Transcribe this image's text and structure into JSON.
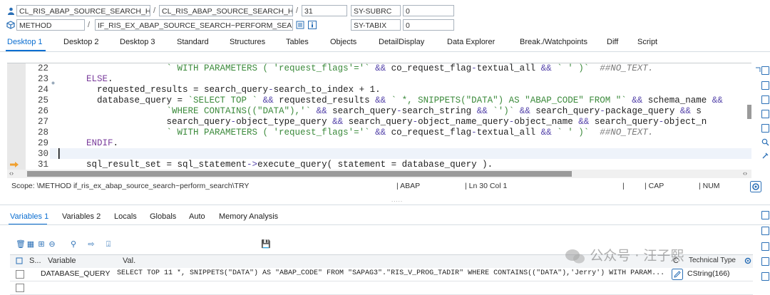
{
  "header": {
    "row1": {
      "class_field": "CL_RIS_ABAP_SOURCE_SEARCH_HAN...",
      "include_field": "CL_RIS_ABAP_SOURCE_SEARCH_HAN...",
      "line_field": "31",
      "var_name": "SY-SUBRC",
      "var_value": "0",
      "sep1": "/",
      "sep2": "/"
    },
    "row2": {
      "type_field": "METHOD",
      "method_field": "IF_RIS_EX_ABAP_SOURCE_SEARCH~PERFORM_SEA...",
      "var_name": "SY-TABIX",
      "var_value": "0",
      "sep1": "/"
    }
  },
  "tabs": [
    "Desktop 1",
    "Desktop 2",
    "Desktop 3",
    "Standard",
    "Structures",
    "Tables",
    "Objects",
    "DetailDisplay",
    "Data Explorer",
    "Break./Watchpoints",
    "Diff",
    "Script"
  ],
  "editor": {
    "line_numbers": [
      "22",
      "23",
      "24",
      "25",
      "26",
      "27",
      "28",
      "29",
      "30",
      "31"
    ],
    "lines": [
      [
        {
          "t": "                     ",
          "c": ""
        },
        {
          "t": "` WITH PARAMETERS ( 'request_flags'='` ",
          "c": "str"
        },
        {
          "t": "&&",
          "c": "op"
        },
        {
          "t": " co_request_flag",
          "c": ""
        },
        {
          "t": "-",
          "c": "op"
        },
        {
          "t": "textual_all ",
          "c": ""
        },
        {
          "t": "&&",
          "c": "op"
        },
        {
          "t": " ",
          "c": ""
        },
        {
          "t": "` ' )`",
          "c": "str"
        },
        {
          "t": "  ##NO_TEXT.",
          "c": "cm"
        }
      ],
      [
        {
          "t": "      ",
          "c": ""
        },
        {
          "t": "ELSE",
          "c": "kw"
        },
        {
          "t": ".",
          "c": ""
        }
      ],
      [
        {
          "t": "        requested_results = search_query",
          "c": ""
        },
        {
          "t": "-",
          "c": "op"
        },
        {
          "t": "search_to_index + 1.",
          "c": ""
        }
      ],
      [
        {
          "t": "        database_query = ",
          "c": ""
        },
        {
          "t": "`SELECT TOP `",
          "c": "str"
        },
        {
          "t": " ",
          "c": ""
        },
        {
          "t": "&&",
          "c": "op"
        },
        {
          "t": " requested_results ",
          "c": ""
        },
        {
          "t": "&&",
          "c": "op"
        },
        {
          "t": " ",
          "c": ""
        },
        {
          "t": "` *, SNIPPETS(\"DATA\") AS \"ABAP_CODE\" FROM \"`",
          "c": "str"
        },
        {
          "t": " ",
          "c": ""
        },
        {
          "t": "&&",
          "c": "op"
        },
        {
          "t": " schema_name ",
          "c": ""
        },
        {
          "t": "&&",
          "c": "op"
        }
      ],
      [
        {
          "t": "                     ",
          "c": ""
        },
        {
          "t": "`WHERE CONTAINS((\"DATA\"),'`",
          "c": "str"
        },
        {
          "t": " ",
          "c": ""
        },
        {
          "t": "&&",
          "c": "op"
        },
        {
          "t": " search_query",
          "c": ""
        },
        {
          "t": "-",
          "c": "op"
        },
        {
          "t": "search_string ",
          "c": ""
        },
        {
          "t": "&&",
          "c": "op"
        },
        {
          "t": " ",
          "c": ""
        },
        {
          "t": "`')`",
          "c": "str"
        },
        {
          "t": " ",
          "c": ""
        },
        {
          "t": "&&",
          "c": "op"
        },
        {
          "t": " search_query",
          "c": ""
        },
        {
          "t": "-",
          "c": "op"
        },
        {
          "t": "package_query ",
          "c": ""
        },
        {
          "t": "&&",
          "c": "op"
        },
        {
          "t": " s",
          "c": ""
        }
      ],
      [
        {
          "t": "                     search_query",
          "c": ""
        },
        {
          "t": "-",
          "c": "op"
        },
        {
          "t": "object_type_query ",
          "c": ""
        },
        {
          "t": "&&",
          "c": "op"
        },
        {
          "t": " search_query",
          "c": ""
        },
        {
          "t": "-",
          "c": "op"
        },
        {
          "t": "object_name_query",
          "c": ""
        },
        {
          "t": "-",
          "c": "op"
        },
        {
          "t": "object_name ",
          "c": ""
        },
        {
          "t": "&&",
          "c": "op"
        },
        {
          "t": " search_query",
          "c": ""
        },
        {
          "t": "-",
          "c": "op"
        },
        {
          "t": "object_n",
          "c": ""
        }
      ],
      [
        {
          "t": "                     ",
          "c": ""
        },
        {
          "t": "` WITH PARAMETERS ( 'request_flags'='` ",
          "c": "str"
        },
        {
          "t": "&&",
          "c": "op"
        },
        {
          "t": " co_request_flag",
          "c": ""
        },
        {
          "t": "-",
          "c": "op"
        },
        {
          "t": "textual_all ",
          "c": ""
        },
        {
          "t": "&&",
          "c": "op"
        },
        {
          "t": " ",
          "c": ""
        },
        {
          "t": "` ' )`",
          "c": "str"
        },
        {
          "t": "  ##NO_TEXT.",
          "c": "cm"
        }
      ],
      [
        {
          "t": "      ",
          "c": ""
        },
        {
          "t": "ENDIF",
          "c": "kw"
        },
        {
          "t": ".",
          "c": ""
        }
      ],
      [
        {
          "t": "",
          "c": ""
        }
      ],
      [
        {
          "t": "      sql_result_set = sql_statement",
          "c": ""
        },
        {
          "t": "->",
          "c": "op"
        },
        {
          "t": "execute_query( statement = database_query ).",
          "c": ""
        }
      ]
    ]
  },
  "status_bar": {
    "scope": "Scope: \\METHOD if_ris_ex_abap_source_search~perform_search\\TRY",
    "language": "| ABAP",
    "position": "| Ln  30 Col  1",
    "bar1": "|",
    "caps": "| CAP",
    "num": "| NUM",
    "dots": "....."
  },
  "bottom_tabs": [
    "Variables 1",
    "Variables 2",
    "Locals",
    "Globals",
    "Auto",
    "Memory Analysis"
  ],
  "variables_table": {
    "headers": {
      "s": "S...",
      "variable": "Variable",
      "value": "Val.",
      "c": "C",
      "technical_type": "Technical Type"
    },
    "rows": [
      {
        "variable": "DATABASE_QUERY",
        "value": "SELECT TOP 11 *, SNIPPETS(\"DATA\") AS \"ABAP_CODE\" FROM \"SAPAG3\".\"RIS_V_PROG_TADIR\" WHERE CONTAINS((\"DATA\"),'Jerry')  WITH PARAM...",
        "technical_type": "CString(166)"
      },
      {
        "variable": "",
        "value": "",
        "technical_type": ""
      }
    ]
  },
  "watermark": "公众号 · 汪子熙",
  "colors": {
    "accent": "#0a6ed1",
    "string": "#3b8a3b",
    "keyword": "#7a3c9c",
    "comment": "#7a7a7a",
    "operator": "#5544aa"
  }
}
